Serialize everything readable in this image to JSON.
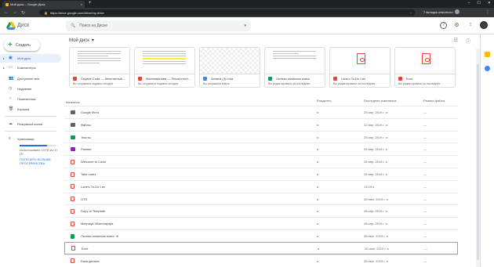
{
  "browser": {
    "tab_title": "Мой диск – Google Диск",
    "tab_close": "×",
    "new_tab": "+",
    "window_controls": [
      "–",
      "☐",
      "✕"
    ],
    "nav": [
      "←",
      "→",
      "↻"
    ],
    "url": "https://drive.google.com/drive/my-drive",
    "incognito": "7 вкладок инкогнито",
    "menu": "⋮"
  },
  "header": {
    "app_name": "Диск",
    "search_placeholder": "Поиск на Диске",
    "help": "?",
    "settings": "⚙",
    "apps": "⋮⋮⋮"
  },
  "sidebar": {
    "create_label": "Создать",
    "items": [
      {
        "label": "Мой диск",
        "icon": "▣",
        "chevron": "▸"
      },
      {
        "label": "Компьютеры",
        "icon": "▭",
        "chevron": "▸"
      },
      {
        "label": "Доступные мне",
        "icon": "👥",
        "chevron": ""
      },
      {
        "label": "Недавние",
        "icon": "◷",
        "chevron": ""
      },
      {
        "label": "Помеченные",
        "icon": "☆",
        "chevron": ""
      },
      {
        "label": "Корзина",
        "icon": "🗑",
        "chevron": ""
      },
      {
        "label": "Резервные копии",
        "icon": "☁",
        "chevron": ""
      },
      {
        "label": "Хранилище",
        "icon": "≡",
        "chevron": ""
      }
    ],
    "storage_used": "Использовано 13 ГБ из 17 ГБ",
    "storage_fraction": 0.76,
    "more_storage": "ПОЛУЧИТЬ БОЛЬШЕ ПРОСТРАНСТВА"
  },
  "main": {
    "title": "Мой диск",
    "title_caret": "▾",
    "view_toggle": "☷",
    "info": "ⓘ",
    "quick_access": [
      {
        "name": "Сервис Coda — бесплатный...",
        "sub": "Вы открывали недавно сегодня",
        "color": "#ea4335"
      },
      {
        "name": "Маллиманова — Пеша отчет...",
        "sub": "Вы открывали недавно сегодня",
        "color": "#ea4335"
      },
      {
        "name": "Записи (3).m4a",
        "sub": "Вы открывали вчера",
        "color": "#4285f4"
      },
      {
        "name": "Личная записная книга",
        "sub": "Вы редактировали за последние...",
        "color": "#0f9d58"
      },
      {
        "name": "Lane's To-Do List",
        "sub": "Вы редактировали за последние...",
        "color": "#ea4335"
      },
      {
        "name": "Блог",
        "sub": "Вы редактировали за последние...",
        "color": "#ea4335"
      }
    ],
    "columns": {
      "name": "Название",
      "sort": "↓",
      "owner": "Владелец",
      "modified": "Последнее изменение",
      "size": "Размер файла"
    },
    "rows": [
      {
        "type": "folder",
        "name": "Google Фото",
        "owner": "я",
        "modified": "25 апр. 2019 г. я",
        "size": "—"
      },
      {
        "type": "folder",
        "name": "Файлы",
        "owner": "я",
        "modified": "12 апр. 2019 г. я",
        "size": "—"
      },
      {
        "type": "green",
        "name": "Тексты",
        "owner": "я",
        "modified": "25 апр. 2019 г. я",
        "size": "—"
      },
      {
        "type": "purple",
        "name": "Ранние",
        "owner": "я",
        "modified": "25 апр. 2019 г. я",
        "size": "—"
      },
      {
        "type": "doc",
        "name": "Welcome to Coda",
        "owner": "я",
        "modified": "28 апр. 2019 г. я",
        "size": "—"
      },
      {
        "type": "doc",
        "name": "Take notes",
        "owner": "я",
        "modified": "28 апр. 2019 г. я",
        "size": "—"
      },
      {
        "type": "doc",
        "name": "Lane's To-Do List",
        "owner": "я",
        "modified": "13:09 я",
        "size": "—"
      },
      {
        "type": "doc",
        "name": "GTD",
        "owner": "я",
        "modified": "26 июл. 2019 г. я",
        "size": "—"
      },
      {
        "type": "doc",
        "name": "Copy of Template",
        "owner": "я",
        "modified": "28 апр. 2019 г. я",
        "size": "—"
      },
      {
        "type": "doc",
        "name": "Матрица Эйзенхауэра",
        "owner": "я",
        "modified": "28 апр. 2019 г. я",
        "size": "—"
      },
      {
        "type": "sheet",
        "name": "Личная записная книга",
        "owner": "я",
        "modified": "28 июл. 2019 г. я",
        "size": "—",
        "starred": true
      },
      {
        "type": "doc",
        "name": "Блог",
        "owner": "я",
        "modified": "26 июл. 2019 г. я",
        "size": "—",
        "selected": true
      },
      {
        "type": "doc",
        "name": "База данных",
        "owner": "я",
        "modified": "26 июл. 2019 г. я",
        "size": "—"
      }
    ]
  }
}
